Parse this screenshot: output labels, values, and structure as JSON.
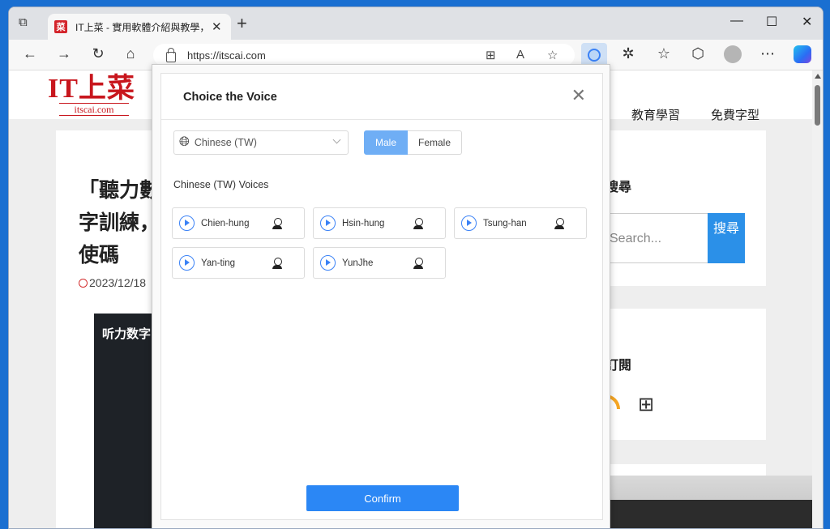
{
  "browser": {
    "tab_title": "IT上菜 - 實用軟體介紹與教學，",
    "tab_favicon": "菜",
    "url": "https://itscai.com",
    "new_tab": "+",
    "minimize": "—",
    "maximize": "☐",
    "close": "✕"
  },
  "site": {
    "logo_main": "IT上菜",
    "logo_sub": "itscai.com",
    "nav": [
      "教育學習",
      "免費字型"
    ],
    "article_title": "「聽力數字訓練，使碼",
    "date": "2023/12/18",
    "hero_text": "听力数字",
    "sidebar_search_heading": "搜尋",
    "search_placeholder": "Search...",
    "search_button": "搜尋",
    "subscribe_heading": "訂閱"
  },
  "dialog": {
    "title": "Choice the Voice",
    "language": "Chinese (TW)",
    "gender_options": [
      "Male",
      "Female"
    ],
    "selected_gender": "Male",
    "section_label": "Chinese (TW) Voices",
    "voices": [
      "Chien-hung",
      "Hsin-hung",
      "Tsung-han",
      "Yan-ting",
      "YunJhe"
    ],
    "confirm": "Confirm"
  },
  "colors": {
    "accent": "#2b87f5",
    "selected_toggle": "#6faef5",
    "brand_red": "#c8161d"
  }
}
